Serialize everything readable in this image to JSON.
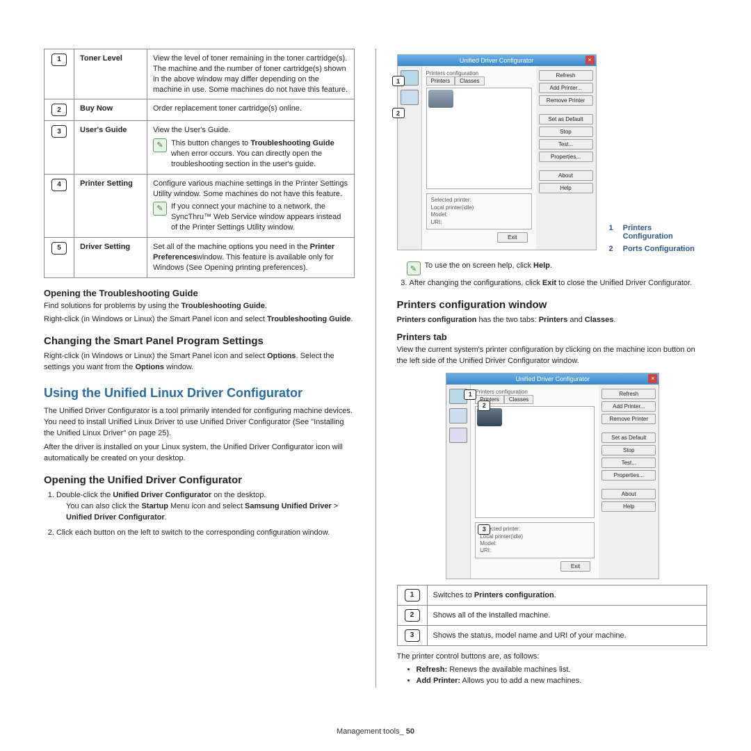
{
  "left": {
    "table": [
      {
        "num": "1",
        "label": "Toner Level",
        "desc": "View the level of toner remaining in the toner cartridge(s). The machine and the number of toner cartridge(s) shown in the above window may differ depending on the machine in use. Some machines do not have this feature."
      },
      {
        "num": "2",
        "label": "Buy Now",
        "desc": "Order replacement toner cartridge(s) online."
      },
      {
        "num": "3",
        "label": "User's Guide",
        "desc": "View the User's Guide.",
        "note_pre": "This button changes to",
        "note_bold": "Troubleshooting Guide",
        "note_post": "when error occurs. You can directly open the troubleshooting section in the user's guide."
      },
      {
        "num": "4",
        "label": "Printer Setting",
        "desc": "Configure various machine settings in the Printer Settings Utility window. Some machines do not have this feature.",
        "note": "If you connect your machine to a network, the SyncThru™ Web Service window appears instead of the Printer Settings Utility window."
      },
      {
        "num": "5",
        "label": "Driver Setting",
        "desc_pre": "Set all of the machine options you need in the",
        "desc_bold": "Printer Preferences",
        "desc_post": "window. This feature is available only for Windows (See Opening printing preferences)."
      }
    ],
    "troubleshoot": {
      "heading": "Opening the Troubleshooting Guide",
      "p1_pre": "Find solutions for problems by using the",
      "p1_bold": "Troubleshooting Guide",
      "p2_pre": "Right-click (in Windows or Linux) the Smart Panel icon and select",
      "p2_bold": "Troubleshooting Guide"
    },
    "changing": {
      "heading": "Changing the Smart Panel Program Settings",
      "p_pre": "Right-click (in Windows or Linux) the Smart Panel icon and select",
      "p_bold1": "Options",
      "p_mid": "Select the settings you want from the",
      "p_bold2": "Options",
      "p_post": "window."
    },
    "unified": {
      "heading": "Using the Unified Linux Driver Configurator",
      "p1": "The Unified Driver Configurator is a tool primarily intended for configuring machine devices. You need to install Unified Linux Driver to use Unified Driver Configurator (See \"Installing the Unified Linux Driver\" on page 25).",
      "p2": "After the driver is installed on your Linux system, the Unified Driver Configurator icon will automatically be created on your desktop."
    },
    "opening": {
      "heading": "Opening the Unified Driver Configurator",
      "li1_pre": "Double-click the",
      "li1_bold": "Unified Driver Configurator",
      "li1_post": "on the desktop.",
      "li1_sub_pre": "You can also click the",
      "li1_sub_bold1": "Startup",
      "li1_sub_mid": "Menu icon and select",
      "li1_sub_bold2": "Samsung Unified Driver",
      "li1_sub_bold3": "Unified Driver Configurator",
      "li2": "Click each button on the left to switch to the corresponding configuration window."
    }
  },
  "right": {
    "ss1": {
      "title": "Unified Driver Configurator",
      "group": "Printers configuration",
      "tab1": "Printers",
      "tab2": "Classes",
      "sel_label": "Selected printer:",
      "sel_line1": "Local printer(idle)",
      "sel_line2": "Model:",
      "sel_line3": "URI:",
      "exit": "Exit",
      "c1": "1",
      "c2": "2"
    },
    "ss2": {
      "c1": "1",
      "c2": "2",
      "c3": "3"
    },
    "buttons": [
      "Refresh",
      "Add Printer...",
      "Remove Printer",
      "Set as Default",
      "Stop",
      "Test...",
      "Properties...",
      "About",
      "Help"
    ],
    "legend1": [
      "Printers Configuration",
      "Ports Configuration"
    ],
    "help_note_pre": "To use the on screen help, click",
    "help_note_bold": "Help",
    "step3_pre": "After changing the configurations, click",
    "step3_bold": "Exit",
    "step3_post": "to close the Unified Driver Configurator.",
    "pcw": {
      "heading": "Printers configuration window",
      "p_bold1": "Printers configuration",
      "p_mid": "has the two tabs:",
      "p_bold2": "Printers",
      "p_and": "and",
      "p_bold3": "Classes"
    },
    "ptab": {
      "heading": "Printers tab",
      "p": "View the current system's printer configuration by clicking on the machine icon button on the left side of the Unified Driver Configurator window."
    },
    "tbl2": [
      {
        "pre": "Switches to",
        "bold": "Printers configuration"
      },
      {
        "text": "Shows all of the installed machine."
      },
      {
        "text": "Shows the status, model name and URI of your machine."
      }
    ],
    "controls_intro": "The printer control buttons are, as follows:",
    "controls": [
      {
        "label": "Refresh:",
        "desc": "Renews the available machines list."
      },
      {
        "label": "Add Printer:",
        "desc": "Allows you to add a new machines."
      }
    ]
  },
  "footer": {
    "text": "Management tools_",
    "page": "50"
  }
}
